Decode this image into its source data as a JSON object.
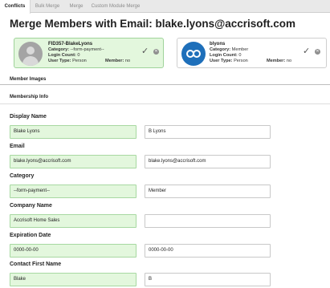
{
  "tabs": [
    {
      "label": "Conflicts"
    },
    {
      "label": "Bulk Merge"
    },
    {
      "label": "Merge"
    },
    {
      "label": "Custom Module Merge"
    }
  ],
  "page_title": "Merge Members with Email: blake.lyons@accrisoft.com",
  "members": [
    {
      "name": "FID357-BlakeLyons",
      "category_label": "Category:",
      "category": "--form-payment--",
      "login_label": "Login Count:",
      "login_count": "0",
      "usertype_label": "User Type:",
      "user_type": "Person",
      "member_label": "Member:",
      "member": "no",
      "avatar_icon": "person-placeholder-icon"
    },
    {
      "name": "blyons",
      "category_label": "Category:",
      "category": "Member",
      "login_label": "Login Count:",
      "login_count": "0",
      "usertype_label": "User Type:",
      "user_type": "Person",
      "member_label": "Member:",
      "member": "no",
      "avatar_icon": "accrisoft-logo-icon"
    }
  ],
  "sections": {
    "member_images": "Member Images",
    "membership_info": "Membership Info"
  },
  "fields": [
    {
      "label": "Display Name",
      "left": "Blake Lyons",
      "right": "B Lyons"
    },
    {
      "label": "Email",
      "left": "blake.lyons@accrisoft.com",
      "right": "blake.lyons@accrisoft.com"
    },
    {
      "label": "Category",
      "left": "--form-payment--",
      "right": "Member"
    },
    {
      "label": "Company Name",
      "left": "Accrisoft Home Sales",
      "right": ""
    },
    {
      "label": "Expiration Date",
      "left": "0000-00-00",
      "right": "0000-00-00"
    },
    {
      "label": "Contact First Name",
      "left": "Blake",
      "right": "B"
    }
  ],
  "colors": {
    "selected_bg": "#e3f7dd",
    "selected_border": "#a7d8a1",
    "tabbar_bg": "#e9e9e9",
    "logo_blue": "#1e6fba"
  }
}
